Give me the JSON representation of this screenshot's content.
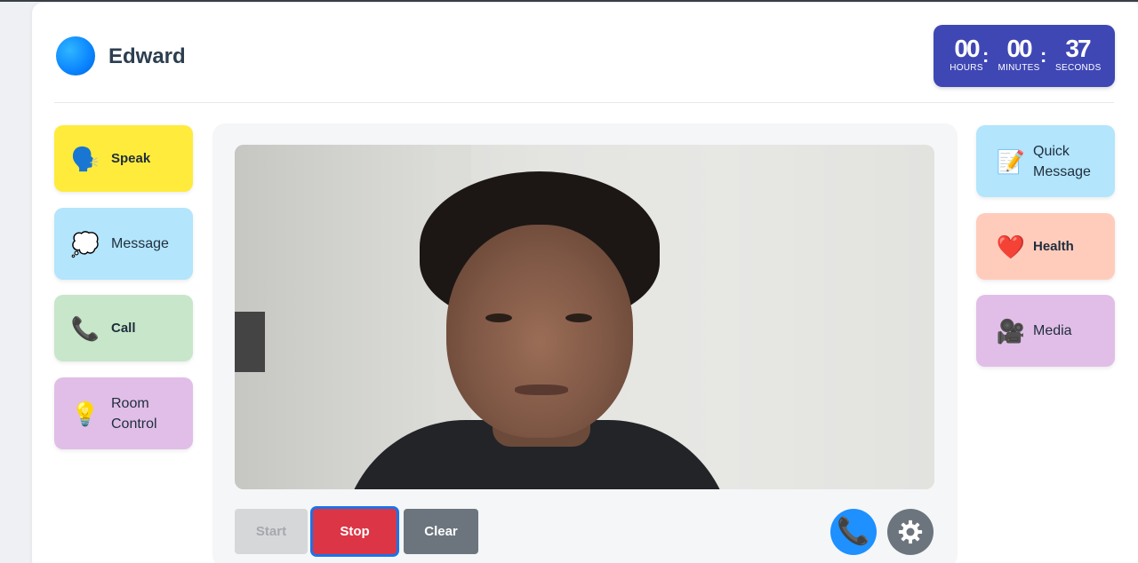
{
  "header": {
    "user_name": "Edward"
  },
  "timer": {
    "hours": "00",
    "minutes": "00",
    "seconds": "37",
    "hours_label": "HOURS",
    "minutes_label": "MINUTES",
    "seconds_label": "SECONDS",
    "separator": ":"
  },
  "left_tiles": [
    {
      "label": "Speak",
      "icon": "speaking-head-icon",
      "color": "#ffeb3b"
    },
    {
      "label": "Message",
      "icon": "speech-bubble-icon",
      "color": "#b3e5fc"
    },
    {
      "label": "Call",
      "icon": "phone-icon",
      "color": "#c8e6c9"
    },
    {
      "label": "Room Control",
      "icon": "light-bulb-icon",
      "color": "#e1bee7"
    }
  ],
  "right_tiles": [
    {
      "label": "Quick Message",
      "icon": "memo-icon",
      "color": "#b3e5fc"
    },
    {
      "label": "Health",
      "icon": "heart-icon",
      "color": "#ffccbc"
    },
    {
      "label": "Media",
      "icon": "video-camera-icon",
      "color": "#e1bee7"
    }
  ],
  "controls": {
    "start_label": "Start",
    "stop_label": "Stop",
    "clear_label": "Clear"
  },
  "colors": {
    "timer_bg": "#3f47b5",
    "stop": "#dc3545",
    "clear": "#6c757d",
    "call_button": "#1e90ff",
    "avatar": "#0a84ff"
  }
}
